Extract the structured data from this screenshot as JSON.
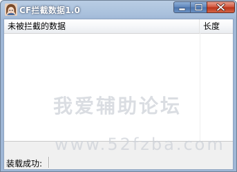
{
  "window": {
    "title": "CF拦截数据1.0",
    "icon": "anime-character-app-icon",
    "buttons": {
      "minimize": "minimize-icon",
      "maximize": "maximize-icon",
      "close": "close-icon"
    }
  },
  "listview": {
    "columns": [
      {
        "label": "未被拦截的数据"
      },
      {
        "label": "长度"
      }
    ],
    "rows": []
  },
  "watermark": {
    "text_cn": "我爱辅助论坛",
    "url": "www.52fzba.com"
  },
  "statusbar": {
    "label": "装载成功:"
  },
  "colors": {
    "titlebar": "#a9c0dc",
    "close_button": "#d0533a",
    "caption_button": "#5f86bb"
  }
}
